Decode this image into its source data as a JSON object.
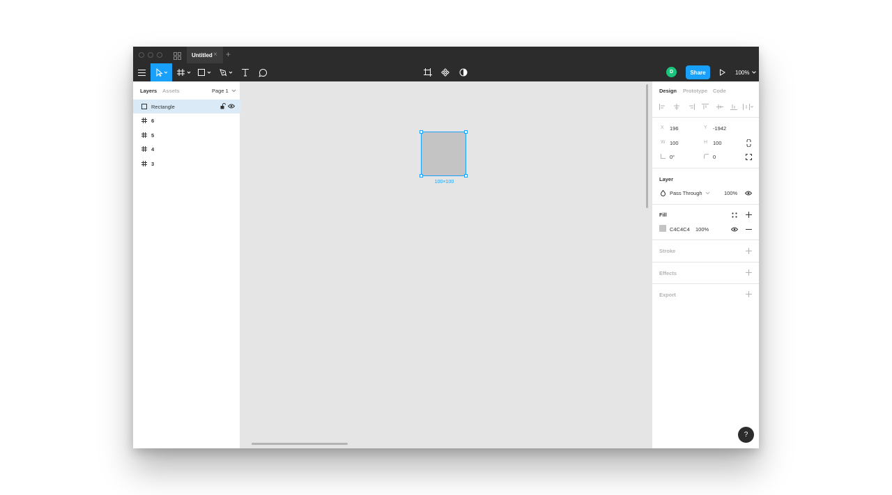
{
  "window": {
    "tab_title": "Untitled",
    "tab_close": "×",
    "tab_add": "+"
  },
  "toolbar": {
    "menu_icon": "hamburger-menu-icon",
    "tools": [
      "move-tool",
      "frame-tool",
      "shape-tool",
      "pen-tool",
      "text-tool",
      "comment-tool"
    ],
    "active_tool": "move-tool",
    "center_tools": [
      "crop-icon",
      "component-icon",
      "contrast-icon"
    ],
    "avatar_initial": "D",
    "share_label": "Share",
    "zoom_label": "100%"
  },
  "left_panel": {
    "tabs": [
      {
        "label": "Layers",
        "active": true
      },
      {
        "label": "Assets",
        "active": false
      }
    ],
    "page_label": "Page 1",
    "layers": [
      {
        "name": "Rectangle",
        "type": "rectangle",
        "selected": true
      },
      {
        "name": "6",
        "type": "frame",
        "selected": false
      },
      {
        "name": "5",
        "type": "frame",
        "selected": false
      },
      {
        "name": "4",
        "type": "frame",
        "selected": false
      },
      {
        "name": "3",
        "type": "frame",
        "selected": false
      }
    ]
  },
  "canvas": {
    "selection_size_label": "100×100",
    "rect_fill": "#C4C4C4",
    "selection_color": "#18A0FB"
  },
  "right_panel": {
    "tabs": [
      {
        "label": "Design",
        "active": true
      },
      {
        "label": "Prototype",
        "active": false
      },
      {
        "label": "Code",
        "active": false
      }
    ],
    "position": {
      "x_label": "X",
      "x_value": "196",
      "y_label": "Y",
      "y_value": "-1942",
      "w_label": "W",
      "w_value": "100",
      "h_label": "H",
      "h_value": "100",
      "rotation_value": "0°",
      "radius_value": "0"
    },
    "layer": {
      "title": "Layer",
      "blend_mode": "Pass Through",
      "opacity": "100%"
    },
    "fill": {
      "title": "Fill",
      "hex": "C4C4C4",
      "opacity": "100%",
      "color": "#C4C4C4"
    },
    "stroke_title": "Stroke",
    "effects_title": "Effects",
    "export_title": "Export",
    "help_label": "?"
  },
  "colors": {
    "accent": "#18A0FB",
    "chrome": "#2C2C2C",
    "avatar": "#1BC47D",
    "canvas": "#E5E5E5",
    "selected_layer": "#DAEBF7"
  }
}
